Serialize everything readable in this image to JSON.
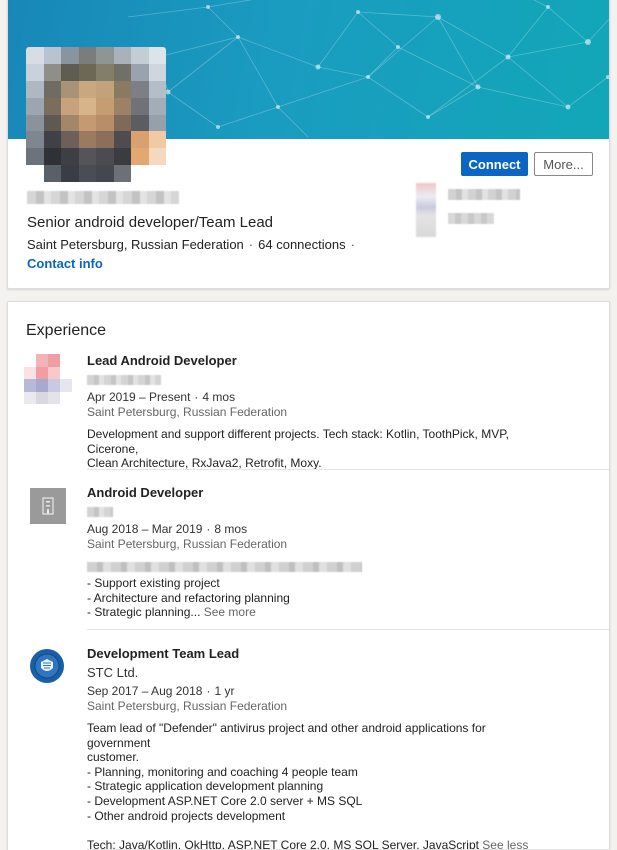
{
  "profile": {
    "headline": "Senior android developer/Team Lead",
    "location": "Saint Petersburg, Russian Federation",
    "connections": "64 connections",
    "separator": "·",
    "contact_info": "Contact info",
    "connect_label": "Connect",
    "more_label": "More..."
  },
  "experience": {
    "title": "Experience",
    "entries": [
      {
        "role": "Lead Android Developer",
        "dates": "Apr 2019 – Present",
        "duration": "4 mos",
        "location": "Saint Petersburg, Russian Federation",
        "description": "Development and support different projects. Tech stack: Kotlin, ToothPick, MVP, Cicerone,\nClean Architecture, RxJava2, Retrofit, Moxy.",
        "logo": "blurred-company-logo"
      },
      {
        "role": "Android Developer",
        "dates": "Aug 2018 – Mar 2019",
        "duration": "8 mos",
        "location": "Saint Petersburg, Russian Federation",
        "description": "- Support existing project\n- Architecture and refactoring planning\n- Strategic planning...",
        "see_more": "See more",
        "logo": "building-icon"
      },
      {
        "role": "Development Team Lead",
        "company": "STC Ltd.",
        "dates": "Sep 2017 – Aug 2018",
        "duration": "1 yr",
        "location": "Saint Petersburg, Russian Federation",
        "description": "Team lead of \"Defender\" antivirus project and other android applications for government\ncustomer.\n- Planning, monitoring and coaching 4 people team\n- Strategic application development planning\n- Development ASP.NET Core 2.0 server + MS SQL\n- Other android projects development\n\nTech: Java/Kotlin, OkHttp, ASP.NET Core 2.0, MS SQL Server, JavaScript",
        "see_less": "See less",
        "logo": "shield-icon"
      }
    ]
  },
  "colors": {
    "accent": "#0a66c2",
    "banner": "#1a9cc0"
  }
}
